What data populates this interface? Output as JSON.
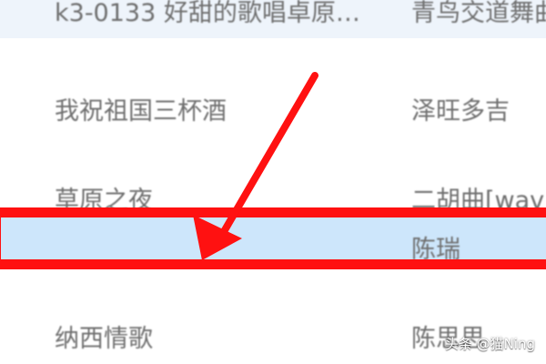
{
  "song_list": {
    "rows": [
      {
        "title": "k3-0133 好甜的歌唱卓原…",
        "artist": "青鸟交道舞曲"
      },
      {
        "title": "我祝祖国三杯酒",
        "artist": "泽旺多吉"
      },
      {
        "title": "草原之夜",
        "artist": "二胡曲[wav"
      },
      {
        "title": "",
        "artist": "陈瑞"
      },
      {
        "title": "纳西情歌",
        "artist": "陈思思"
      }
    ],
    "selected_index": 3
  },
  "annotation": {
    "color": "#ff1111"
  },
  "watermark": "头条 @猫Ning",
  "colors": {
    "selected_row": "#cde6fb",
    "alt_row": "#eef4fb",
    "text": "#6f6f6f"
  }
}
